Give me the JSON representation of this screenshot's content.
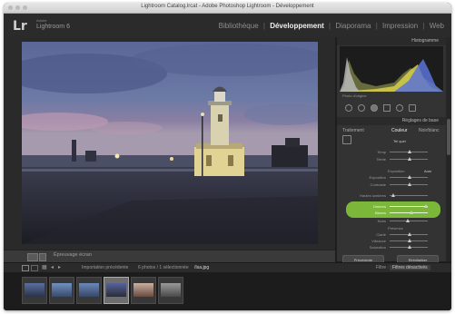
{
  "window": {
    "title": "Lightroom Catalog.lrcat - Adobe Photoshop Lightroom - Développement"
  },
  "app": {
    "logo": "Lr",
    "adobe": "Adobe",
    "name": "Lightroom 6"
  },
  "modules": [
    {
      "label": "Bibliothèque",
      "active": false
    },
    {
      "label": "Développement",
      "active": true
    },
    {
      "label": "Diaporama",
      "active": false
    },
    {
      "label": "Impression",
      "active": false
    },
    {
      "label": "Web",
      "active": false
    }
  ],
  "module_separator": "|",
  "right_panel": {
    "histogram_header": "Histogramme",
    "original_photo": "Photo d'origine",
    "basic_header": "Réglages de base",
    "tabs": [
      "Traitement",
      "Couleur",
      "Noir/blanc"
    ],
    "rows": [
      {
        "label": "Balance des blancs",
        "value": "Tel quel"
      },
      {
        "label": "Temp",
        "value": ""
      },
      {
        "label": "Teinte",
        "value": ""
      },
      {
        "label": "Exposition",
        "value": "Auto"
      },
      {
        "label": "Exposition",
        "value": "0,00"
      },
      {
        "label": "Contraste",
        "value": "0"
      },
      {
        "label": "Hautes lumières",
        "value": "-100"
      },
      {
        "label": "Ombres",
        "value": "+100"
      },
      {
        "label": "Blancs",
        "value": "+7"
      },
      {
        "label": "Noirs",
        "value": "-17"
      },
      {
        "label": "Présence",
        "value": ""
      },
      {
        "label": "Clarté",
        "value": "0"
      },
      {
        "label": "Vibrance",
        "value": "0"
      },
      {
        "label": "Saturation",
        "value": "0"
      }
    ],
    "btn_previous": "Précédente",
    "btn_reset": "Réinitialiser"
  },
  "loupe_toolbar": {
    "soft_proof": "Épreuvage écran"
  },
  "filmstrip_bar": {
    "source": "Importation précédente",
    "count": "6 photos / 1 sélectionnée",
    "filename": "/Isa.jpg",
    "filter_label": "Filtre :",
    "filter_value": "Filtres désactivés"
  },
  "colors": {
    "highlight_band": "#7bb83a",
    "active_module": "#f0f0f0"
  }
}
